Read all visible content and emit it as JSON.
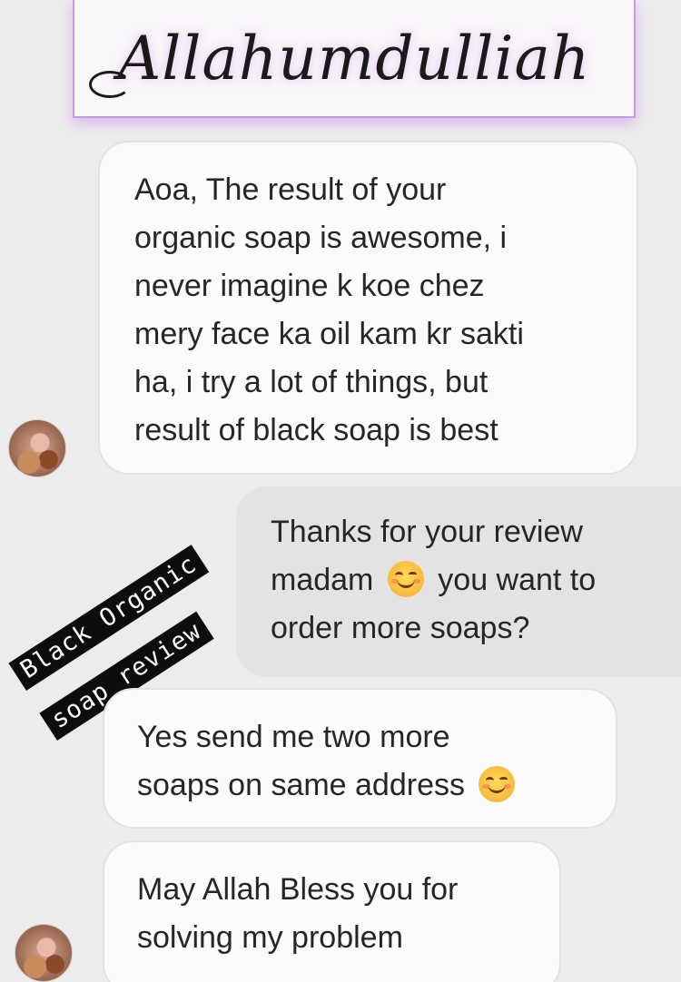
{
  "title": {
    "text": "Allahumdulliah"
  },
  "sticker": {
    "line1": "Black Organic",
    "line2": "soap review"
  },
  "messages": [
    {
      "direction": "incoming",
      "lines": [
        "Aoa,  The result of your",
        "organic soap is awesome, i",
        "never imagine k koe chez",
        "mery face ka oil kam kr sakti",
        "ha, i try a lot of things, but",
        "result of black soap is best"
      ]
    },
    {
      "direction": "outgoing",
      "line1": "Thanks for your review",
      "line2_before": "madam",
      "line2_after": "you want to",
      "line3": "order more soaps?",
      "emoji": "smiling-face-icon"
    },
    {
      "direction": "incoming",
      "line1": "Yes send me two more",
      "line2": "soaps on same address",
      "emoji": "smiling-face-icon"
    },
    {
      "direction": "incoming",
      "lines": [
        "May Allah Bless you for",
        "solving my problem"
      ]
    }
  ],
  "colors": {
    "background": "#ececec",
    "incoming_bubble": "#fbfbfb",
    "outgoing_bubble": "#e3e3e3",
    "title_glow": "#c79be6",
    "sticker_bg": "#0d0d0d"
  }
}
